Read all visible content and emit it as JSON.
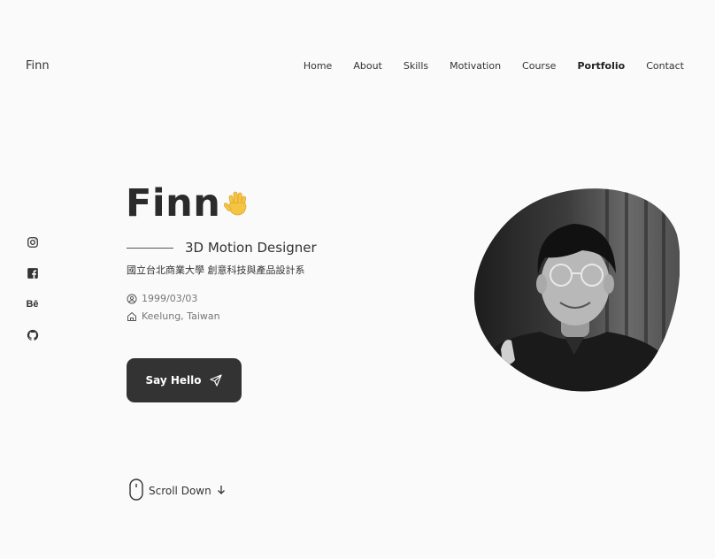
{
  "header": {
    "logo": "Finn",
    "nav": [
      "Home",
      "About",
      "Skills",
      "Motivation",
      "Course",
      "Portfolio",
      "Contact"
    ],
    "active_nav": "Portfolio"
  },
  "social": {
    "icons": [
      "instagram-icon",
      "facebook-icon",
      "behance-icon",
      "github-icon"
    ],
    "behance_label": "Bē"
  },
  "hero": {
    "name": "Finn",
    "subtitle": "3D Motion Designer",
    "school": "國立台北商業大學 創意科技與產品設計系",
    "dob": "1999/03/03",
    "location": "Keelung, Taiwan",
    "cta_label": "Say Hello",
    "scroll_label": "Scroll Down"
  },
  "colors": {
    "background": "#fafafa",
    "text": "#333333",
    "button": "#333333",
    "wave_emoji": "#f5c443"
  }
}
